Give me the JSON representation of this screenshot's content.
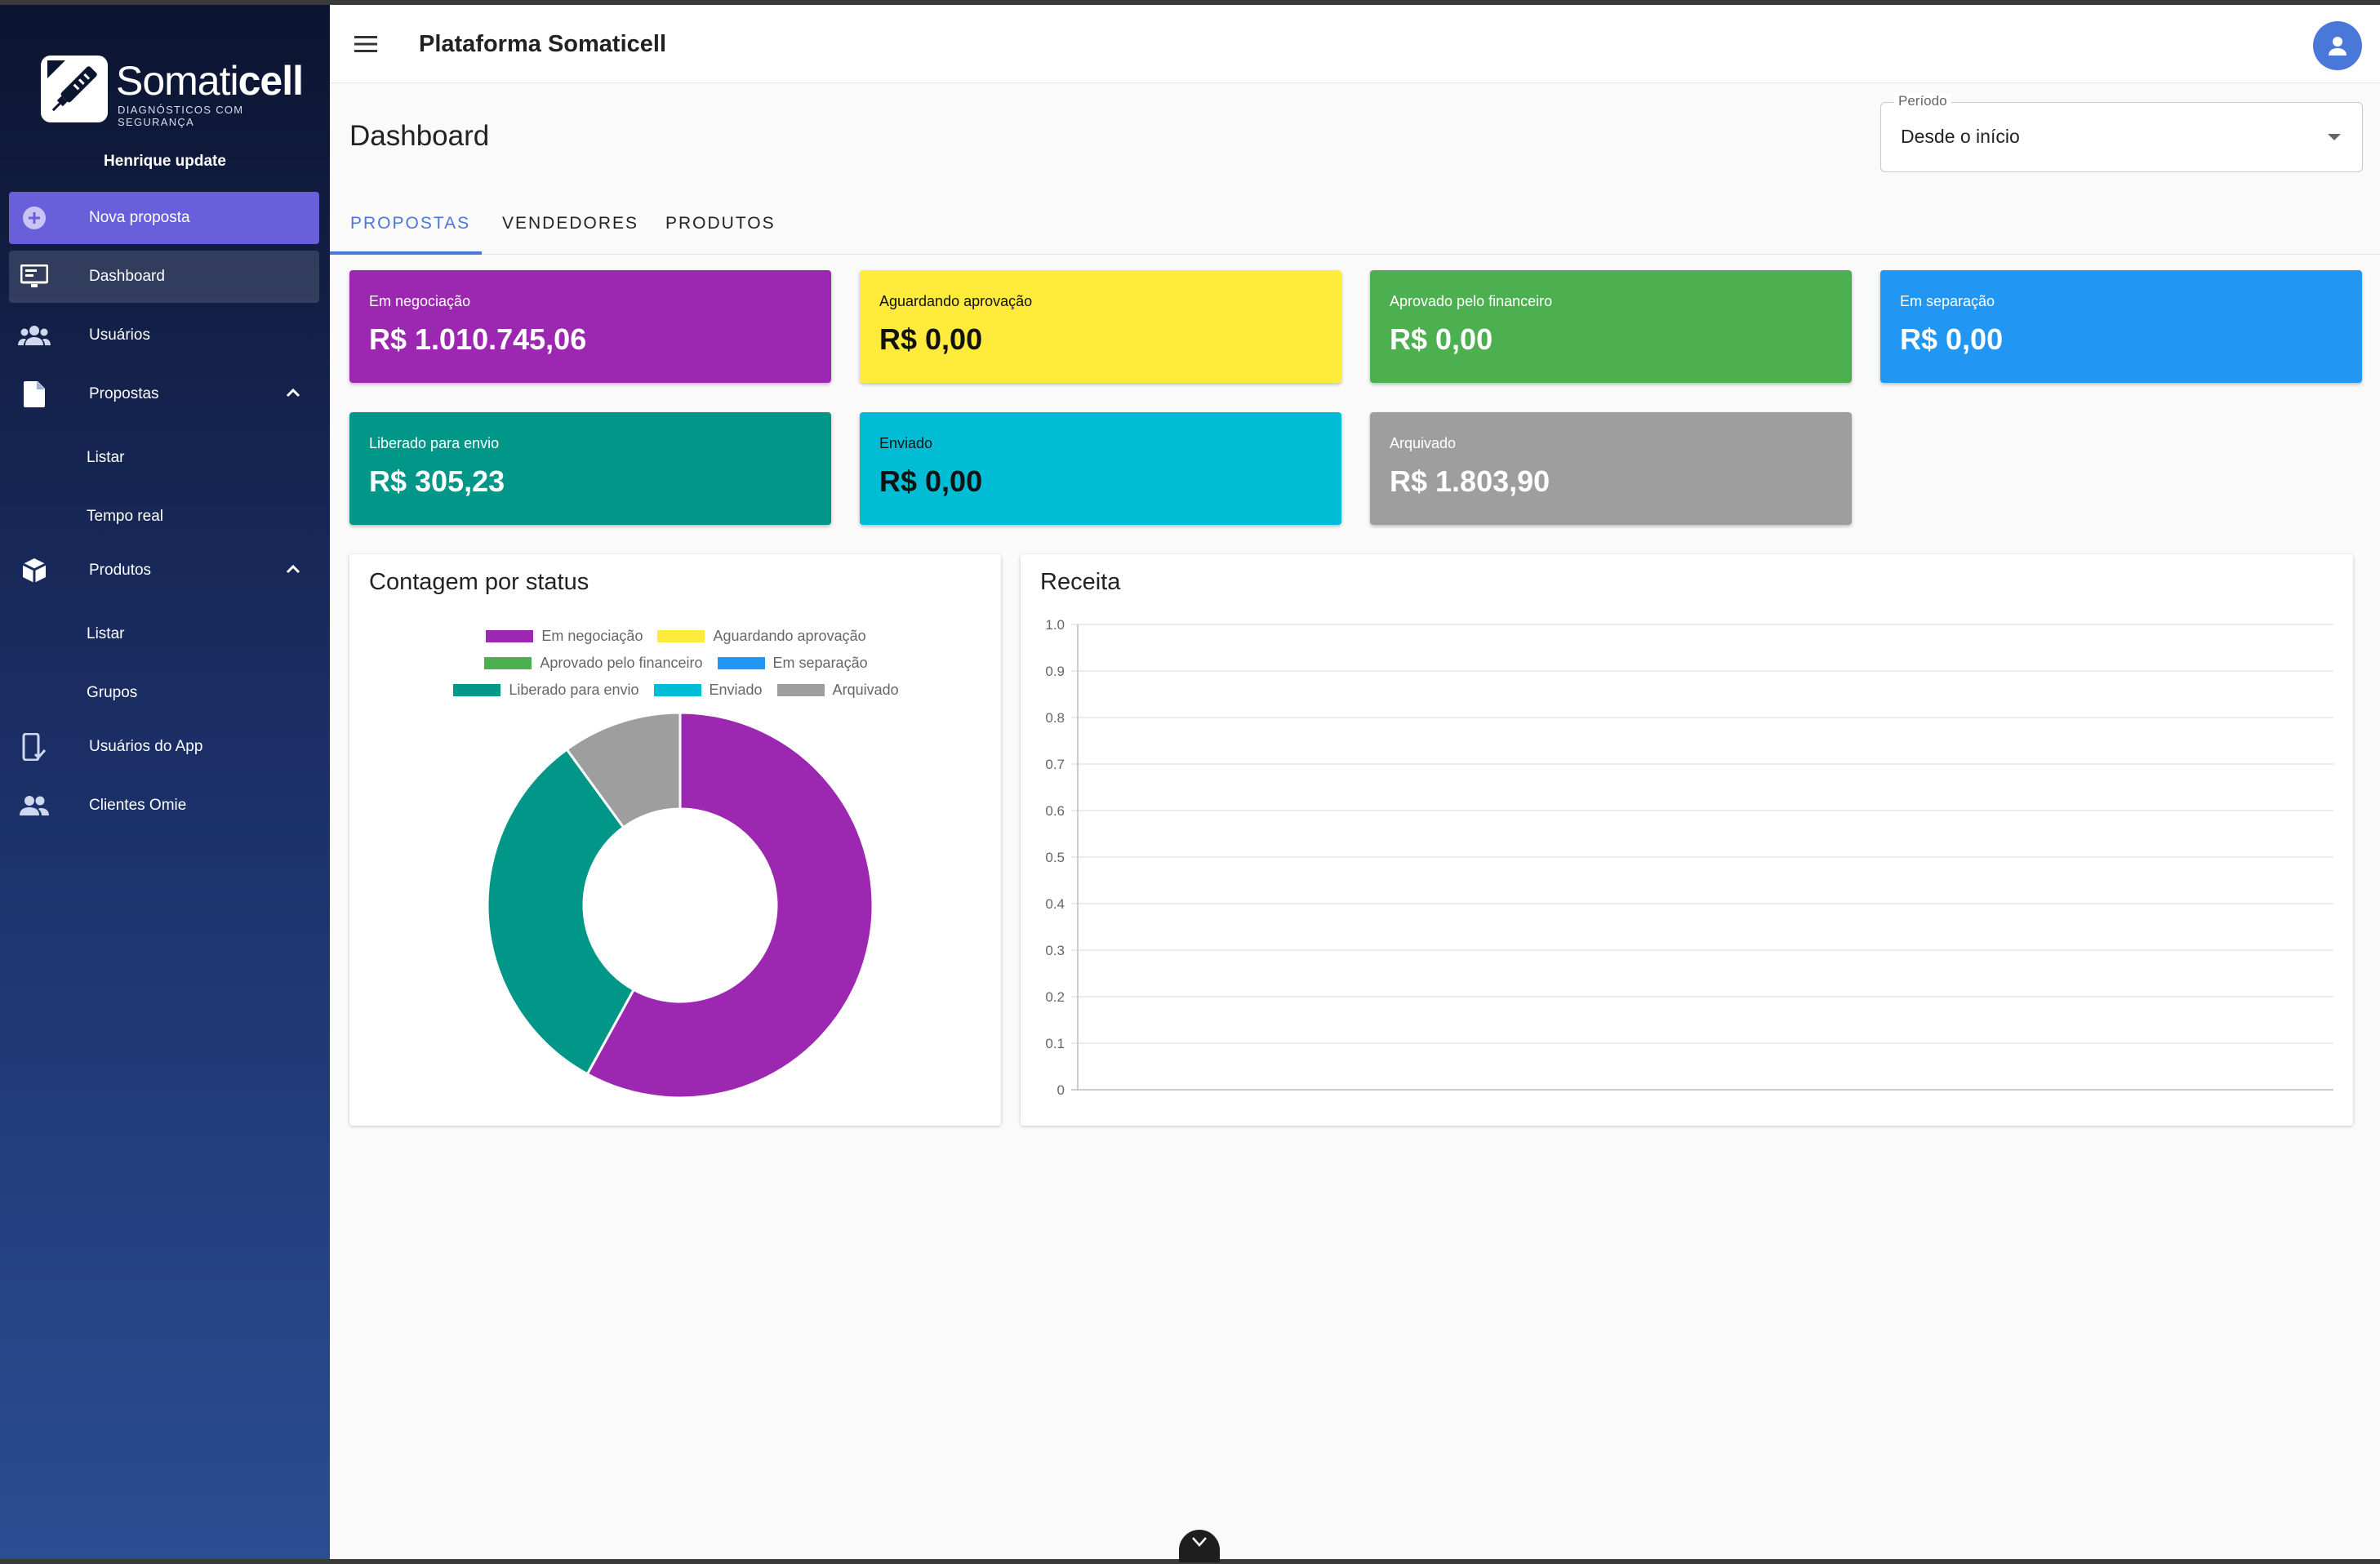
{
  "brand": {
    "name_light": "Somati",
    "name_bold": "cell",
    "tagline": "DIAGNÓSTICOS COM SEGURANÇA"
  },
  "sidebar": {
    "user_name": "Henrique update",
    "new_proposal": "Nova proposta",
    "items": [
      {
        "label": "Dashboard",
        "icon": "monitor-icon"
      },
      {
        "label": "Usuários",
        "icon": "users-icon"
      },
      {
        "label": "Propostas",
        "icon": "document-icon"
      },
      {
        "label": "Listar"
      },
      {
        "label": "Tempo real"
      },
      {
        "label": "Produtos",
        "icon": "box-icon"
      },
      {
        "label": "Listar"
      },
      {
        "label": "Grupos"
      },
      {
        "label": "Usuários do App",
        "icon": "phone-check-icon"
      },
      {
        "label": "Clientes Omie",
        "icon": "people-icon"
      }
    ]
  },
  "header": {
    "title": "Plataforma Somaticell"
  },
  "page": {
    "title": "Dashboard"
  },
  "period": {
    "label": "Período",
    "value": "Desde o início"
  },
  "tabs": [
    "PROPOSTAS",
    "VENDEDORES",
    "PRODUTOS"
  ],
  "cards": [
    {
      "label": "Em negociação",
      "value": "R$ 1.010.745,06",
      "color": "#9c27b0"
    },
    {
      "label": "Aguardando aprovação",
      "value": "R$ 0,00",
      "color": "#ffeb3b"
    },
    {
      "label": "Aprovado pelo financeiro",
      "value": "R$ 0,00",
      "color": "#4caf50"
    },
    {
      "label": "Em separação",
      "value": "R$ 0,00",
      "color": "#2196f3"
    },
    {
      "label": "Liberado para envio",
      "value": "R$ 305,23",
      "color": "#009688"
    },
    {
      "label": "Enviado",
      "value": "R$ 0,00",
      "color": "#00bcd4"
    },
    {
      "label": "Arquivado",
      "value": "R$ 1.803,90",
      "color": "#9e9e9e"
    }
  ],
  "chart_data": [
    {
      "type": "pie",
      "title": "Contagem por status",
      "donut": true,
      "legend": "top",
      "labels": [
        "Em negociação",
        "Aguardando aprovação",
        "Aprovado pelo financeiro",
        "Em separação",
        "Liberado para envio",
        "Enviado",
        "Arquivado"
      ],
      "values": [
        58,
        0,
        0,
        0,
        32,
        0,
        10
      ],
      "colors": [
        "#9c27b0",
        "#ffeb3b",
        "#4caf50",
        "#2196f3",
        "#009688",
        "#00bcd4",
        "#9e9e9e"
      ]
    },
    {
      "type": "line",
      "title": "Receita",
      "series": [],
      "ylim": [
        0,
        1.0
      ],
      "yticks": [
        "1.0",
        "0.9",
        "0.8",
        "0.7",
        "0.6",
        "0.5",
        "0.4",
        "0.3",
        "0.2",
        "0.1",
        "0"
      ],
      "grid": true
    }
  ]
}
